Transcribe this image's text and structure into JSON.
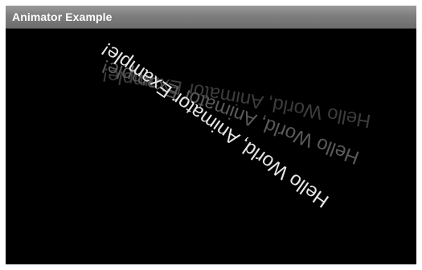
{
  "window": {
    "title": "Animator Example"
  },
  "animation": {
    "text": "Hello World, Animator Example!"
  },
  "colors": {
    "title_bar": "#7e7e7e",
    "background": "#000000",
    "text_primary": "#e6e6e6",
    "text_trail_1": "#5a5a5a",
    "text_trail_2": "#3c3c3c"
  }
}
